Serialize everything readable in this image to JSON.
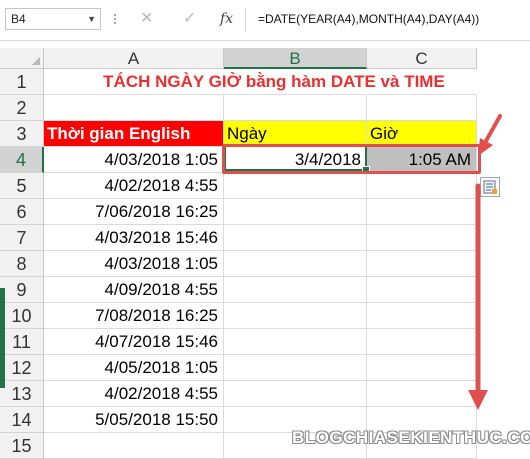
{
  "formula_bar": {
    "name_box": "B4",
    "cancel_glyph": "✕",
    "enter_glyph": "✓",
    "fx_label": "fx",
    "formula": "=DATE(YEAR(A4),MONTH(A4),DAY(A4))"
  },
  "columns": [
    "A",
    "B",
    "C"
  ],
  "selected_column": "B",
  "selected_row": "4",
  "rows": [
    {
      "num": "1",
      "a": "",
      "b": "",
      "c": ""
    },
    {
      "num": "2",
      "a": "",
      "b": "",
      "c": ""
    },
    {
      "num": "3",
      "a": "Thời gian English",
      "b": "Ngày",
      "c": "Giờ"
    },
    {
      "num": "4",
      "a": "4/03/2018 1:05",
      "b": "3/4/2018",
      "c": "1:05 AM"
    },
    {
      "num": "5",
      "a": "4/02/2018 4:55",
      "b": "",
      "c": ""
    },
    {
      "num": "6",
      "a": "7/06/2018 16:25",
      "b": "",
      "c": ""
    },
    {
      "num": "7",
      "a": "4/03/2018 15:46",
      "b": "",
      "c": ""
    },
    {
      "num": "8",
      "a": "4/03/2018 1:05",
      "b": "",
      "c": ""
    },
    {
      "num": "9",
      "a": "4/09/2018 4:55",
      "b": "",
      "c": ""
    },
    {
      "num": "10",
      "a": "7/08/2018 16:25",
      "b": "",
      "c": ""
    },
    {
      "num": "11",
      "a": "4/07/2018 15:46",
      "b": "",
      "c": ""
    },
    {
      "num": "12",
      "a": "4/05/2018 1:05",
      "b": "",
      "c": ""
    },
    {
      "num": "13",
      "a": "4/02/2018 4:55",
      "b": "",
      "c": ""
    },
    {
      "num": "14",
      "a": "5/05/2018 15:50",
      "b": "",
      "c": ""
    },
    {
      "num": "15",
      "a": "",
      "b": "",
      "c": ""
    }
  ],
  "title": "TÁCH NGÀY GIỜ bằng hàm DATE và TIME",
  "watermark": "BLOGCHIASEKIENTHUC.COM",
  "colors": {
    "title": "#e8312f",
    "header_a_bg": "#ff0000",
    "header_a_text": "#ffffff",
    "header_bc_bg": "#ffff00",
    "c4_bg": "#bfbfbf",
    "selection": "#217346",
    "annotation": "#e0504e"
  },
  "icons": {
    "name_box_dropdown": "chevron-down-icon",
    "formula_options": "vertical-dots-icon",
    "cancel": "cancel-icon",
    "enter": "enter-icon",
    "function": "insert-function-icon",
    "quick_analysis": "quick-analysis-icon"
  }
}
